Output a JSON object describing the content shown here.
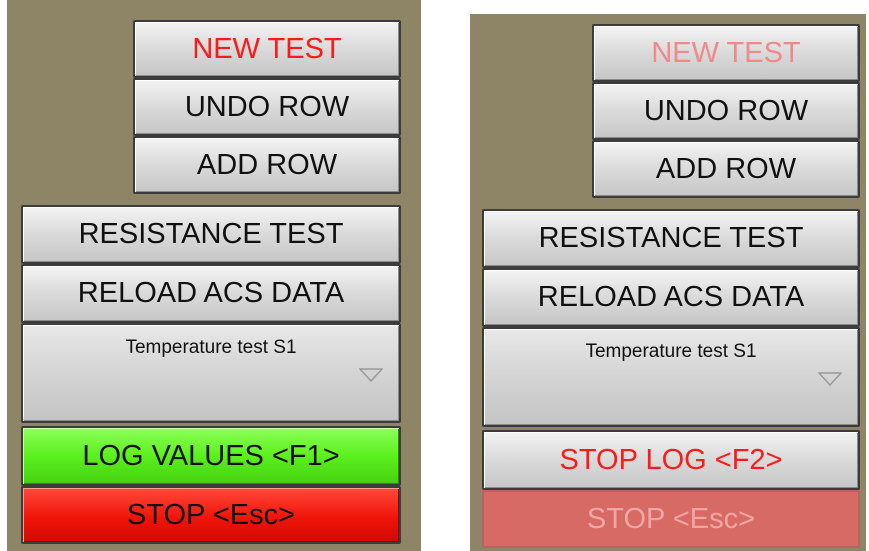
{
  "left_panel": {
    "new_test": "NEW TEST",
    "undo_row": "UNDO ROW",
    "add_row": "ADD ROW",
    "resistance_test": "RESISTANCE TEST",
    "reload_acs_data": "RELOAD ACS DATA",
    "test_select": {
      "value": "Temperature test S1"
    },
    "log_values": "LOG VALUES <F1>",
    "stop": "STOP <Esc>"
  },
  "right_panel": {
    "new_test": "NEW TEST",
    "undo_row": "UNDO ROW",
    "add_row": "ADD ROW",
    "resistance_test": "RESISTANCE TEST",
    "reload_acs_data": "RELOAD ACS DATA",
    "test_select": {
      "value": "Temperature test S1"
    },
    "stop_log": "STOP LOG <F2>",
    "stop": "STOP <Esc>"
  },
  "colors": {
    "panel_background": "#8e8466",
    "button_gray": "#d6d6d6",
    "log_values_green": "#5cf01e",
    "stop_red": "#f0140a",
    "red_text": "#ff1a1a",
    "disabled_stop": "#d86a66"
  },
  "icons": {
    "dropdown": "triangle-down-icon"
  }
}
